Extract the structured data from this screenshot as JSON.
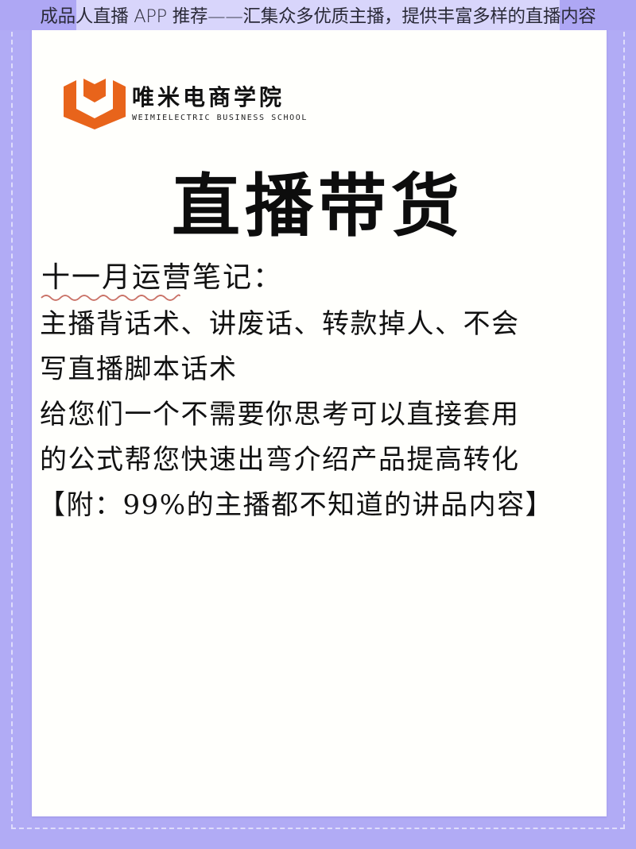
{
  "overlay_title": "成品人直播 APP 推荐——汇集众多优质主播，提供丰富多样的直播内容",
  "colors": {
    "background": "#b1abf5",
    "title_strip": "#d8d5fb",
    "card": "#fffffc",
    "logo_orange": "#e8641b",
    "squiggle": "#c0574a",
    "text": "#111111"
  },
  "logo": {
    "icon": "shield-chevron-logo-icon",
    "name_cn": "唯米电商学院",
    "name_en": "WEIMIELECTRIC BUSINESS SCHOOL"
  },
  "headline": "直播带货",
  "notes": {
    "title": "十一月运营笔记：",
    "lines": [
      "主播背话术、讲废话、转款掉人、不会",
      "写直播脚本话术",
      "给您们一个不需要你思考可以直接套用",
      "的公式帮您快速出弯介绍产品提高转化",
      "【附：99%的主播都不知道的讲品内容】"
    ]
  }
}
